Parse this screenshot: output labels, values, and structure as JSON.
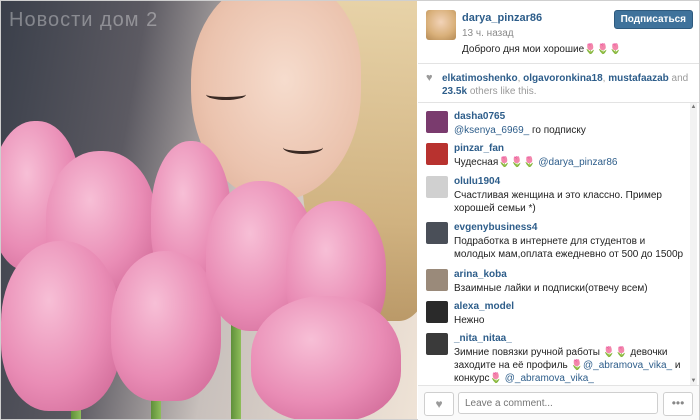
{
  "photo": {
    "watermark": "Новости дом 2"
  },
  "post": {
    "username": "darya_pinzar86",
    "time": "13 ч. назад",
    "caption": "Доброго дня мои хорошие🌷🌷🌷",
    "follow_label": "Подписаться"
  },
  "likes": {
    "users": [
      "elkatimoshenko",
      "olgavoronkina18",
      "mustafaazab"
    ],
    "and_word": "and",
    "count": "23.5k",
    "suffix": "others like this."
  },
  "comments": [
    {
      "user": "dasha0765",
      "mention": "@ksenya_6969_",
      "text": " го подписку",
      "avatar_color": "#7a3b6e"
    },
    {
      "user": "pinzar_fan",
      "text": "Чудесная🌷🌷🌷 ",
      "mention": "@darya_pinzar86",
      "avatar_color": "#b8322f"
    },
    {
      "user": "olulu1904",
      "text": "Счастливая женщина и это классно. Пример хорошей семьи *)",
      "avatar_color": "#d0d0d0"
    },
    {
      "user": "evgenybusiness4",
      "text": "Подработка в интернете для студентов и молодых мам,оплата ежедневно от 500 до 1500р",
      "avatar_color": "#4a4f58"
    },
    {
      "user": "arina_koba",
      "text": "Взаимные лайки и подписки(отвечу всем)",
      "avatar_color": "#9a8a7a"
    },
    {
      "user": "alexa_model",
      "text": "Нежно",
      "avatar_color": "#2a2a2a"
    },
    {
      "user": "_nita_nitaa_",
      "text_before": "Зимние повязки ручной работы 🌷🌷 девочки заходите на её профиль 🌷",
      "mention1": "@_abramova_vika_",
      "text_mid": " и конкурс🌷 ",
      "mention2": "@_abramova_vika_",
      "avatar_color": "#3a3a3a"
    }
  ],
  "input": {
    "placeholder": "Leave a comment..."
  },
  "icons": {
    "heart": "heart-icon",
    "more": "more-icon"
  }
}
